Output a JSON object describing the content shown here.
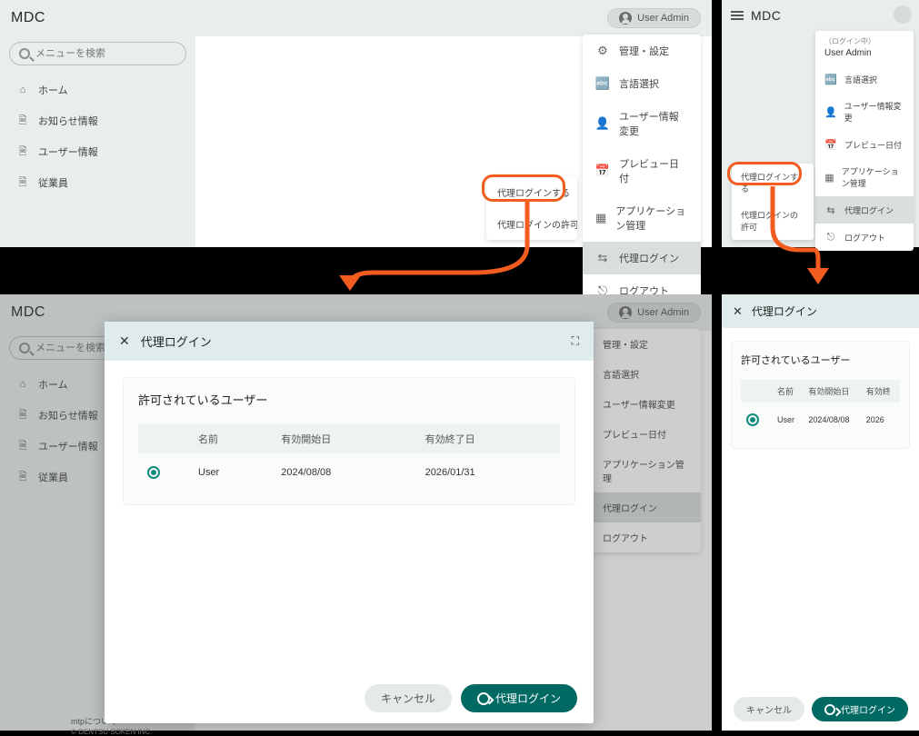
{
  "brand": "MDC",
  "user_chip": "User Admin",
  "search_placeholder": "メニューを検索",
  "sidebar": [
    {
      "icon": "home",
      "label": "ホーム"
    },
    {
      "icon": "doc",
      "label": "お知らせ情報"
    },
    {
      "icon": "doc",
      "label": "ユーザー情報"
    },
    {
      "icon": "doc",
      "label": "従業員"
    }
  ],
  "user_menu": [
    {
      "icon": "gear",
      "label": "管理・設定"
    },
    {
      "icon": "lang",
      "label": "言語選択"
    },
    {
      "icon": "user",
      "label": "ユーザー情報変更"
    },
    {
      "icon": "cal",
      "label": "プレビュー日付"
    },
    {
      "icon": "grid",
      "label": "アプリケーション管理"
    },
    {
      "icon": "swap",
      "label": "代理ログイン",
      "selected": true
    },
    {
      "icon": "logout",
      "label": "ログアウト"
    }
  ],
  "proxy_submenu": [
    {
      "label": "代理ログインする"
    },
    {
      "label": "代理ログインの許可"
    }
  ],
  "mobile_menu_header": {
    "status": "（ログイン中）",
    "name": "User Admin"
  },
  "mobile_menu": [
    {
      "icon": "lang",
      "label": "言語選択"
    },
    {
      "icon": "user",
      "label": "ユーザー情報変更"
    },
    {
      "icon": "cal",
      "label": "プレビュー日付"
    },
    {
      "icon": "grid",
      "label": "アプリケーション管理"
    },
    {
      "icon": "swap",
      "label": "代理ログイン",
      "selected": true
    },
    {
      "icon": "logout",
      "label": "ログアウト"
    }
  ],
  "modal": {
    "title": "代理ログイン",
    "section_title": "許可されているユーザー",
    "columns": {
      "name": "名前",
      "start": "有効開始日",
      "end": "有効終了日"
    },
    "rows": [
      {
        "name": "User",
        "start": "2024/08/08",
        "end": "2026/01/31"
      }
    ],
    "cancel": "キャンセル",
    "submit": "代理ログイン"
  },
  "mobile_modal": {
    "title": "代理ログイン",
    "section_title": "許可されているユーザー",
    "columns": {
      "name": "名前",
      "start": "有効開始日",
      "end_short": "有効終"
    },
    "rows": [
      {
        "name": "User",
        "start": "2024/08/08",
        "end_short": "2026"
      }
    ],
    "cancel": "キャンセル",
    "submit": "代理ログイン"
  },
  "footer": {
    "line1": "mtpについて",
    "line2": "© DENTSU SOKEN INC."
  },
  "icons": {
    "home": "⌂",
    "doc": "🗎",
    "gear": "⚙",
    "lang": "🔤",
    "user": "👤",
    "cal": "📅",
    "grid": "▦",
    "swap": "⇆",
    "logout": "⎋"
  }
}
